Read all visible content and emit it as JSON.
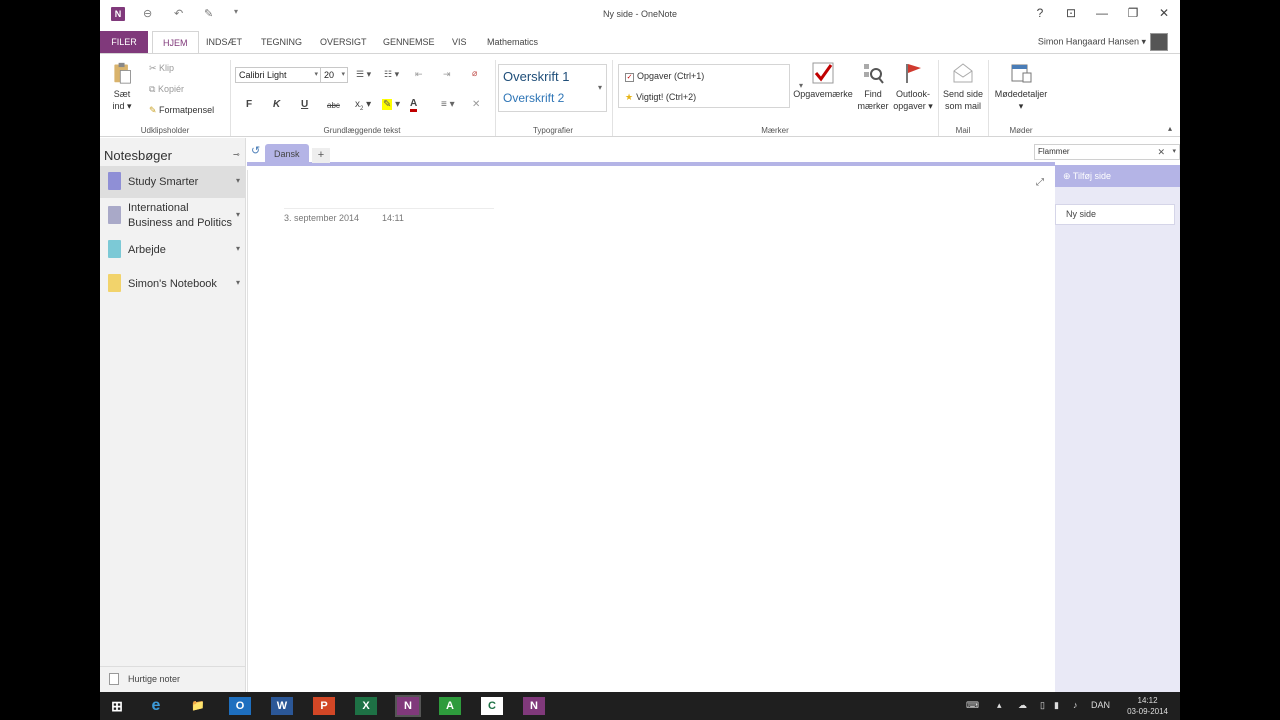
{
  "window": {
    "title": "Ny side - OneNote"
  },
  "ribbon_tabs": [
    "FILER",
    "HJEM",
    "INDSÆT",
    "TEGNING",
    "OVERSIGT",
    "GENNEMSE",
    "VIS",
    "Mathematics"
  ],
  "user": {
    "name": "Simon Hangaard Hansen"
  },
  "clipboard": {
    "paste_label": "Sæt",
    "paste_label2": "ind",
    "cut": "Klip",
    "copy": "Kopiér",
    "format_painter": "Formatpensel",
    "group": "Udklipsholder"
  },
  "basic_text": {
    "font": "Calibri Light",
    "size": "20",
    "bold": "F",
    "italic": "K",
    "underline": "U",
    "strike": "abc",
    "subscript": "x",
    "group": "Grundlæggende tekst"
  },
  "styles": {
    "h1": "Overskrift 1",
    "h2": "Overskrift 2",
    "group": "Typografier"
  },
  "tags": {
    "todo": "Opgaver (Ctrl+1)",
    "important": "Vigtigt! (Ctrl+2)",
    "todo_tag": "Opgavemærke",
    "find_tags_1": "Find",
    "find_tags_2": "mærker",
    "outlook_tasks_1": "Outlook-",
    "outlook_tasks_2": "opgaver",
    "group": "Mærker"
  },
  "mail": {
    "send_1": "Send side",
    "send_2": "som mail",
    "group": "Mail"
  },
  "meetings": {
    "details": "Mødedetaljer",
    "group": "Møder"
  },
  "notebooks": {
    "title": "Notesbøger",
    "items": [
      {
        "label": "Study Smarter",
        "color": "#8f8fd6"
      },
      {
        "label": "International Business and Politics",
        "color": "#a9a9c8"
      },
      {
        "label": "Arbejde",
        "color": "#7cc9d6"
      },
      {
        "label": "Simon's Notebook",
        "color": "#f2d36b"
      }
    ],
    "quick_notes": "Hurtige noter"
  },
  "section": {
    "tab": "Dansk",
    "add": "+"
  },
  "page": {
    "date": "3. september 2014",
    "time": "14:11"
  },
  "search": {
    "value": "Flammer"
  },
  "pages": {
    "add_page": "Tilføj side",
    "items": [
      "Ny side"
    ]
  },
  "taskbar": {
    "apps": [
      "e",
      "📁",
      "O",
      "W",
      "P",
      "X",
      "N",
      "A",
      "C",
      "N"
    ],
    "lang": "DAN",
    "time": "14:12",
    "date": "03-09-2014"
  }
}
